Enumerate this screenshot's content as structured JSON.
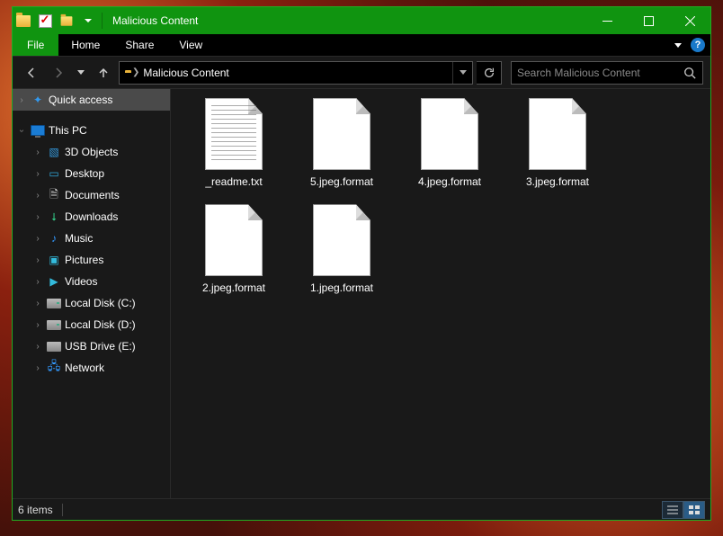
{
  "window": {
    "title": "Malicious Content"
  },
  "menu": {
    "file": "File",
    "home": "Home",
    "share": "Share",
    "view": "View"
  },
  "address": {
    "current": "Malicious Content"
  },
  "search": {
    "placeholder": "Search Malicious Content"
  },
  "sidebar": {
    "quick_access": "Quick access",
    "this_pc": "This PC",
    "items": [
      {
        "label": "3D Objects"
      },
      {
        "label": "Desktop"
      },
      {
        "label": "Documents"
      },
      {
        "label": "Downloads"
      },
      {
        "label": "Music"
      },
      {
        "label": "Pictures"
      },
      {
        "label": "Videos"
      },
      {
        "label": "Local Disk (C:)"
      },
      {
        "label": "Local Disk (D:)"
      },
      {
        "label": "USB Drive (E:)"
      },
      {
        "label": "Network"
      }
    ]
  },
  "files": [
    {
      "name": "_readme.txt",
      "kind": "txt"
    },
    {
      "name": "5.jpeg.format",
      "kind": "blank"
    },
    {
      "name": "4.jpeg.format",
      "kind": "blank"
    },
    {
      "name": "3.jpeg.format",
      "kind": "blank"
    },
    {
      "name": "2.jpeg.format",
      "kind": "blank"
    },
    {
      "name": "1.jpeg.format",
      "kind": "blank"
    }
  ],
  "status": {
    "count": "6 items"
  }
}
